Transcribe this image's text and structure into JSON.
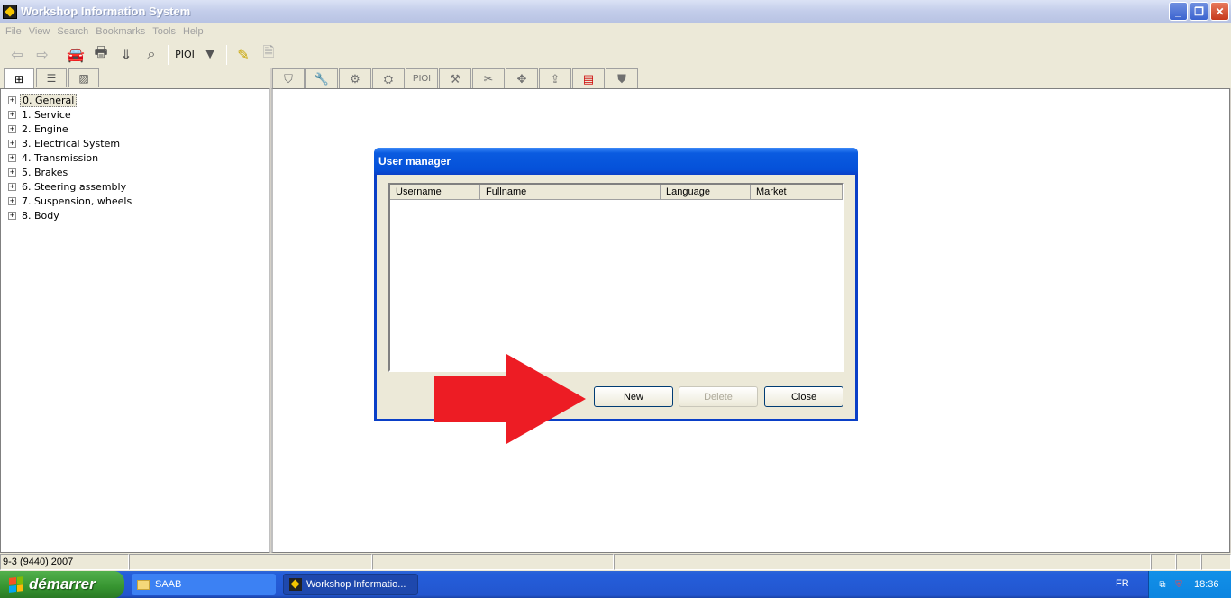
{
  "window": {
    "title": "Workshop Information System"
  },
  "menu": [
    "File",
    "View",
    "Search",
    "Bookmarks",
    "Tools",
    "Help"
  ],
  "toolbar": {
    "pioi_label": "PIOI"
  },
  "tree": [
    {
      "label": "0. General",
      "selected": true
    },
    {
      "label": "1. Service"
    },
    {
      "label": "2. Engine"
    },
    {
      "label": "3. Electrical System"
    },
    {
      "label": "4. Transmission"
    },
    {
      "label": "5. Brakes"
    },
    {
      "label": "6. Steering assembly"
    },
    {
      "label": "7. Suspension, wheels"
    },
    {
      "label": "8. Body"
    }
  ],
  "right_tabs": {
    "pioi_label": "PIOI"
  },
  "status": {
    "vehicle": "9-3 (9440) 2007"
  },
  "dialog": {
    "title": "User manager",
    "columns": [
      "Username",
      "Fullname",
      "Language",
      "Market"
    ],
    "buttons": {
      "new": "New",
      "delete": "Delete",
      "close": "Close"
    }
  },
  "annotation": {
    "arrow_color": "#ed1c24"
  },
  "taskbar": {
    "start_label": "démarrer",
    "tasks": [
      "SAAB",
      "Workshop Informatio..."
    ],
    "language": "FR",
    "clock": "18:36"
  }
}
